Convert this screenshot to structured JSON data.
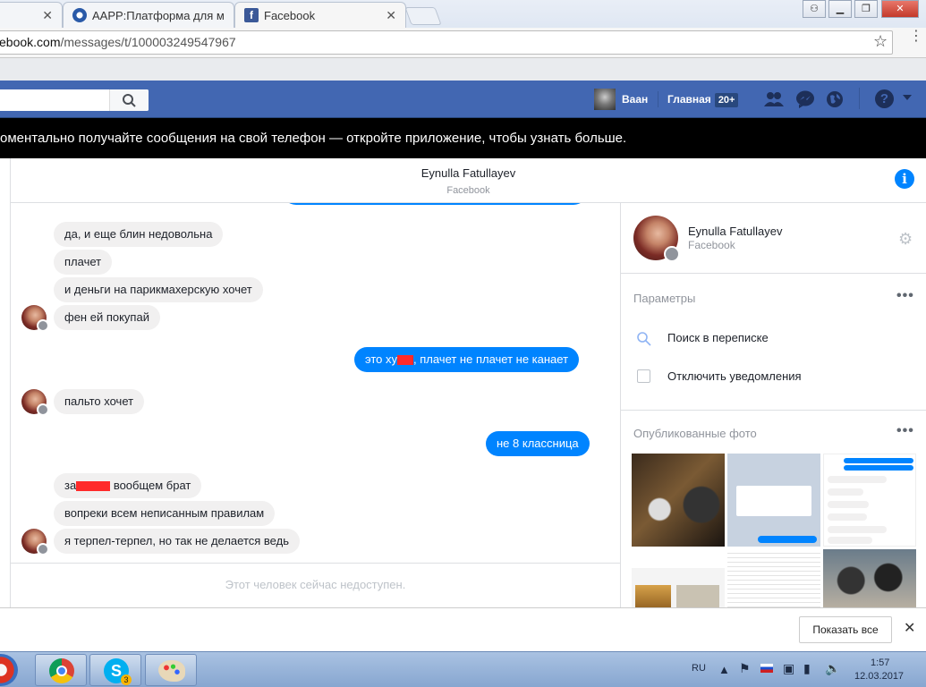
{
  "browser": {
    "tabs": [
      {
        "title": "AAPP:Платформа для м",
        "close": "✕"
      },
      {
        "title": "Facebook",
        "close": "✕"
      }
    ],
    "first_tab_close": "✕",
    "url_domain": "ebook.com",
    "url_path": "/messages/t/100003249547967",
    "star": "☆"
  },
  "fb_header": {
    "user_name": "Ваан",
    "home_label": "Главная",
    "home_badge": "20+",
    "help": "?"
  },
  "banner": {
    "text": "оментально получайте сообщения на свой телефон — откройте приложение, чтобы узнать больше."
  },
  "chat": {
    "title": "Eynulla Fatullayev",
    "subtitle": "Facebook",
    "info_icon": "i",
    "messages": [
      {
        "dir": "in",
        "text": "да, и еще блин недовольна"
      },
      {
        "dir": "in",
        "text": "плачет"
      },
      {
        "dir": "in",
        "text": "и деньги на парикмахерскую хочет"
      },
      {
        "dir": "in",
        "text": "фен ей покупай"
      },
      {
        "dir": "out",
        "text_before": "это ху",
        "text_after": ", плачет не плачет не канает"
      },
      {
        "dir": "in",
        "text": "пальто хочет"
      },
      {
        "dir": "out",
        "text": "не 8 классница"
      },
      {
        "dir": "in",
        "text_before": "за",
        "text_after": " вообщем брат"
      },
      {
        "dir": "in",
        "text": "вопреки всем неписанным правилам"
      },
      {
        "dir": "in",
        "text": "я терпел-терпел, но так не делается ведь"
      }
    ],
    "unavailable": "Этот человек сейчас недоступен."
  },
  "sidebar": {
    "name": "Eynulla Fatullayev",
    "subtitle": "Facebook",
    "params_title": "Параметры",
    "options": [
      "Поиск в переписке",
      "Отключить уведомления"
    ],
    "photos_title": "Опубликованные фото",
    "more": "•••"
  },
  "downloads": {
    "show_all": "Показать все",
    "close": "✕"
  },
  "taskbar": {
    "lang": "RU",
    "time": "1:57",
    "date": "12.03.2017",
    "skype_badge": "3"
  }
}
